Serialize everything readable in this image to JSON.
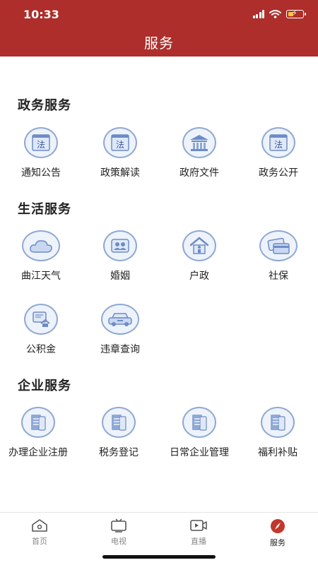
{
  "status": {
    "time": "10:33"
  },
  "header": {
    "title": "服务"
  },
  "sections": [
    {
      "title": "政务服务",
      "items": [
        {
          "label": "通知公告",
          "icon": "law-book-icon",
          "glyph": "法"
        },
        {
          "label": "政策解读",
          "icon": "law-book-icon",
          "glyph": "法"
        },
        {
          "label": "政府文件",
          "icon": "government-building-icon"
        },
        {
          "label": "政务公开",
          "icon": "law-book-icon",
          "glyph": "法"
        }
      ]
    },
    {
      "title": "生活服务",
      "items": [
        {
          "label": "曲江天气",
          "icon": "cloud-icon"
        },
        {
          "label": "婚姻",
          "icon": "couple-icon"
        },
        {
          "label": "户政",
          "icon": "household-icon"
        },
        {
          "label": "社保",
          "icon": "social-security-card-icon"
        },
        {
          "label": "公积金",
          "icon": "housing-fund-icon"
        },
        {
          "label": "违章查询",
          "icon": "car-icon"
        }
      ]
    },
    {
      "title": "企业服务",
      "items": [
        {
          "label": "办理企业注册",
          "icon": "document-icon"
        },
        {
          "label": "税务登记",
          "icon": "document-icon"
        },
        {
          "label": "日常企业管理",
          "icon": "document-icon"
        },
        {
          "label": "福利补贴",
          "icon": "document-icon"
        }
      ]
    }
  ],
  "tabbar": [
    {
      "label": "首页",
      "icon": "home-icon"
    },
    {
      "label": "电视",
      "icon": "tv-icon"
    },
    {
      "label": "直播",
      "icon": "live-video-icon"
    },
    {
      "label": "服务",
      "icon": "compass-icon",
      "active": true
    }
  ],
  "colors": {
    "header": "#ad2e2a",
    "icon_stroke": "#8fa8d6",
    "icon_fill": "#eef3fb",
    "active_tab": "#c0392b"
  }
}
